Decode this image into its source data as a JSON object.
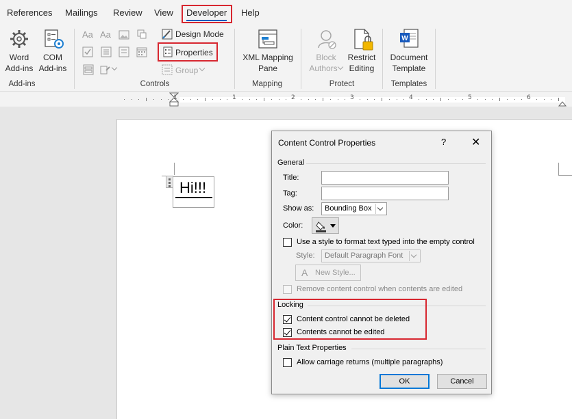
{
  "tabs": [
    "References",
    "Mailings",
    "Review",
    "View",
    "Developer",
    "Help"
  ],
  "active_tab": "Developer",
  "ribbon": {
    "addins": {
      "word_addins": [
        "Word",
        "Add-ins"
      ],
      "com_addins": [
        "COM",
        "Add-ins"
      ],
      "group_label": "Add-ins"
    },
    "controls": {
      "design_mode": "Design Mode",
      "properties": "Properties",
      "group_btn": "Group",
      "group_label": "Controls"
    },
    "mapping": {
      "xml_mapping": [
        "XML Mapping",
        "Pane"
      ],
      "group_label": "Mapping"
    },
    "protect": {
      "block_authors": [
        "Block",
        "Authors"
      ],
      "restrict_editing": [
        "Restrict",
        "Editing"
      ],
      "group_label": "Protect"
    },
    "templates": {
      "document_template": [
        "Document",
        "Template"
      ],
      "group_label": "Templates"
    }
  },
  "ruler": {
    "numbers": [
      "1",
      "1",
      "2",
      "3",
      "4",
      "5",
      "6"
    ]
  },
  "document": {
    "content_control_text": "Hi!!!"
  },
  "dialog": {
    "title": "Content Control Properties",
    "help": "?",
    "close": "✕",
    "general_label": "General",
    "title_label": "Title:",
    "title_value": "",
    "tag_label": "Tag:",
    "tag_value": "",
    "show_as_label": "Show as:",
    "show_as_value": "Bounding Box",
    "color_label": "Color:",
    "use_style_label": "Use a style to format text typed into the empty control",
    "style_label": "Style:",
    "style_value": "Default Paragraph Font",
    "new_style": "New Style...",
    "remove_label": "Remove content control when contents are edited",
    "locking_label": "Locking",
    "cannot_delete": "Content control cannot be deleted",
    "cannot_edit": "Contents cannot be edited",
    "plain_text_label": "Plain Text Properties",
    "allow_returns": "Allow carriage returns (multiple paragraphs)",
    "ok": "OK",
    "cancel": "Cancel"
  },
  "colors": {
    "accent": "#185abd",
    "highlight_border": "#d7262f",
    "default_button": "#0078d7"
  },
  "icons": [
    "gear-icon",
    "com-addins-icon",
    "design-mode-icon",
    "properties-icon",
    "xml-mapping-icon",
    "block-authors-icon",
    "restrict-editing-icon",
    "word-template-icon",
    "color-picker-icon"
  ]
}
